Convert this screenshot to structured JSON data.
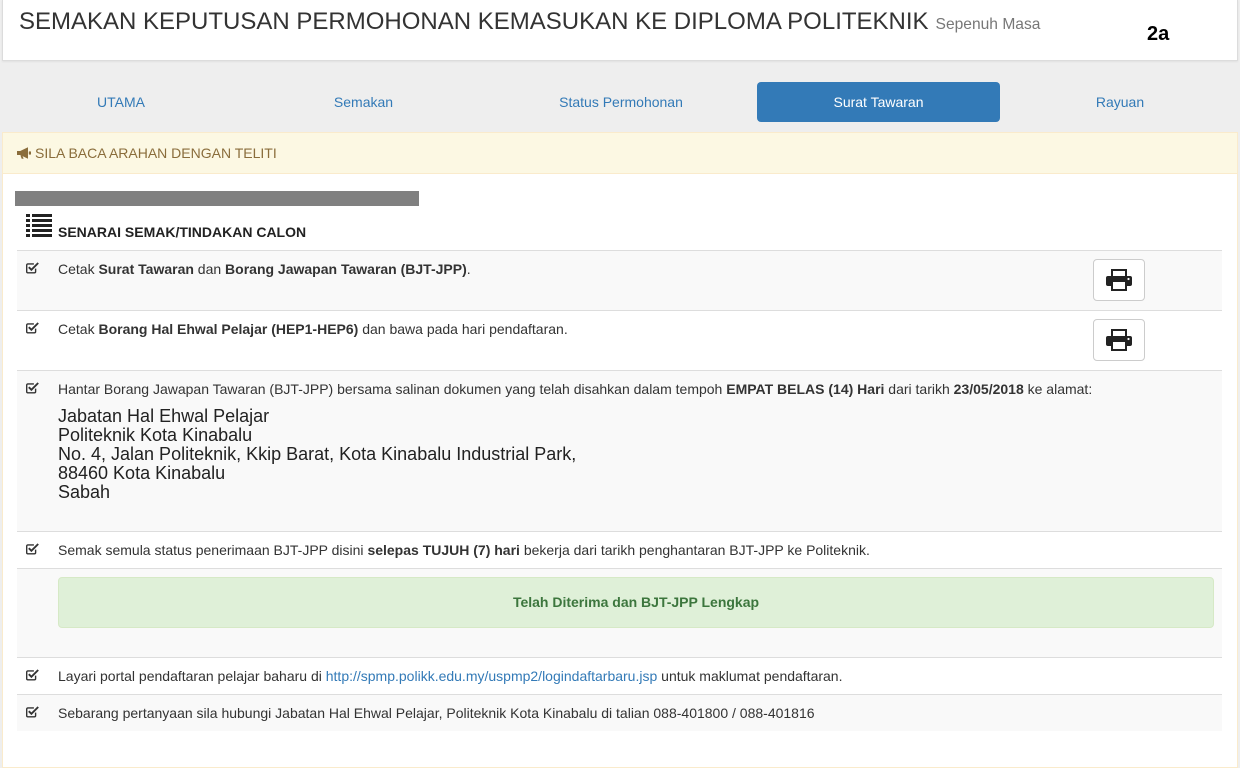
{
  "header": {
    "title": "SEMAKAN KEPUTUSAN PERMOHONAN KEMASUKAN KE DIPLOMA POLITEKNIK",
    "subtitle": "Sepenuh Masa",
    "label": "2a"
  },
  "nav": {
    "tabs": [
      {
        "label": "UTAMA",
        "active": false
      },
      {
        "label": "Semakan",
        "active": false
      },
      {
        "label": "Status Permohonan",
        "active": false
      },
      {
        "label": "Surat Tawaran",
        "active": true
      },
      {
        "label": "Rayuan",
        "active": false
      }
    ]
  },
  "notice": {
    "icon": "bullhorn-icon",
    "text": "SILA BACA ARAHAN DENGAN TELITI"
  },
  "checklist": {
    "icon": "list-icon",
    "title": "SENARAI SEMAK/TINDAKAN CALON",
    "items": [
      {
        "checked": true,
        "text": [
          "Cetak ",
          "Surat Tawaran",
          " dan ",
          "Borang Jawapan Tawaran (BJT-JPP)",
          "."
        ],
        "action_icon": "print-icon"
      },
      {
        "checked": true,
        "text": [
          "Cetak ",
          "Borang Hal Ehwal Pelajar (HEP1-HEP6)",
          " dan bawa pada hari pendaftaran."
        ],
        "action_icon": "print-icon"
      },
      {
        "checked": true,
        "text": [
          "Hantar Borang Jawapan Tawaran (BJT-JPP) bersama salinan dokumen yang telah disahkan dalam tempoh ",
          "EMPAT BELAS (14) Hari",
          " dari tarikh ",
          "23/05/2018",
          " ke alamat:"
        ],
        "address": [
          "Jabatan Hal Ehwal Pelajar",
          "Politeknik Kota Kinabalu",
          "No. 4, Jalan Politeknik, Kkip Barat, Kota Kinabalu Industrial Park,",
          "88460 Kota Kinabalu",
          "Sabah"
        ]
      },
      {
        "checked": true,
        "text": [
          "Semak semula status penerimaan BJT-JPP disini ",
          "selepas TUJUH (7) hari",
          " bekerja dari tarikh penghantaran BJT-JPP ke Politeknik."
        ],
        "status": "Telah Diterima dan BJT-JPP Lengkap"
      },
      {
        "checked": true,
        "text": [
          "Layari portal pendaftaran pelajar baharu di ",
          "http://spmp.polikk.edu.my/uspmp2/logindaftarbaru.jsp",
          " untuk maklumat pendaftaran."
        ]
      },
      {
        "checked": true,
        "text": [
          "Sebarang pertanyaan sila hubungi Jabatan Hal Ehwal Pelajar, Politeknik Kota Kinabalu di talian 088-401800 / 088-401816"
        ]
      }
    ]
  },
  "colors": {
    "primary": "#337ab7",
    "warning_bg": "#fcf8e3",
    "warning_border": "#faebcc",
    "warning_text": "#8a6d3b",
    "success_bg": "#dff0d8",
    "success_border": "#d6e9c6",
    "success_text": "#3c763d",
    "stripe": "#f9f9f9"
  }
}
